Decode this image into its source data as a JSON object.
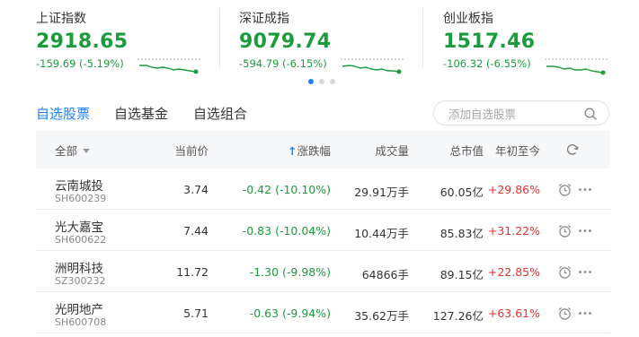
{
  "indices": [
    {
      "name": "上证指数",
      "value": "2918.65",
      "change": "-159.69 (-5.19%)"
    },
    {
      "name": "深证成指",
      "value": "9079.74",
      "change": "-594.79 (-6.15%)"
    },
    {
      "name": "创业板指",
      "value": "1517.46",
      "change": "-106.32 (-6.55%)"
    }
  ],
  "carousel": {
    "pages": 3,
    "active_page": 1
  },
  "colors": {
    "down": "#1a9c3c",
    "up": "#e33030",
    "accent": "#1e80ff"
  },
  "tabs": [
    {
      "label": "自选股票",
      "active": true
    },
    {
      "label": "自选基金",
      "active": false
    },
    {
      "label": "自选组合",
      "active": false
    }
  ],
  "search": {
    "placeholder": "添加自选股票",
    "icon": "search-icon"
  },
  "table": {
    "headers": {
      "all": "全部",
      "price": "当前价",
      "change": "涨跌幅",
      "sort_arrow": "↑",
      "volume": "成交量",
      "market_cap": "总市值",
      "ytd": "年初至今"
    },
    "rows": [
      {
        "name": "云南城投",
        "code": "SH600239",
        "price": "3.74",
        "change": "-0.42 (-10.10%)",
        "volume": "29.91万手",
        "market_cap": "60.05亿",
        "ytd": "+29.86%"
      },
      {
        "name": "光大嘉宝",
        "code": "SH600622",
        "price": "7.44",
        "change": "-0.83 (-10.04%)",
        "volume": "10.44万手",
        "market_cap": "85.83亿",
        "ytd": "+31.22%"
      },
      {
        "name": "洲明科技",
        "code": "SZ300232",
        "price": "11.72",
        "change": "-1.30 (-9.98%)",
        "volume": "64866手",
        "market_cap": "89.15亿",
        "ytd": "+22.85%"
      },
      {
        "name": "光明地产",
        "code": "SH600708",
        "price": "5.71",
        "change": "-0.63 (-9.94%)",
        "volume": "35.62万手",
        "market_cap": "127.26亿",
        "ytd": "+63.61%"
      }
    ]
  }
}
